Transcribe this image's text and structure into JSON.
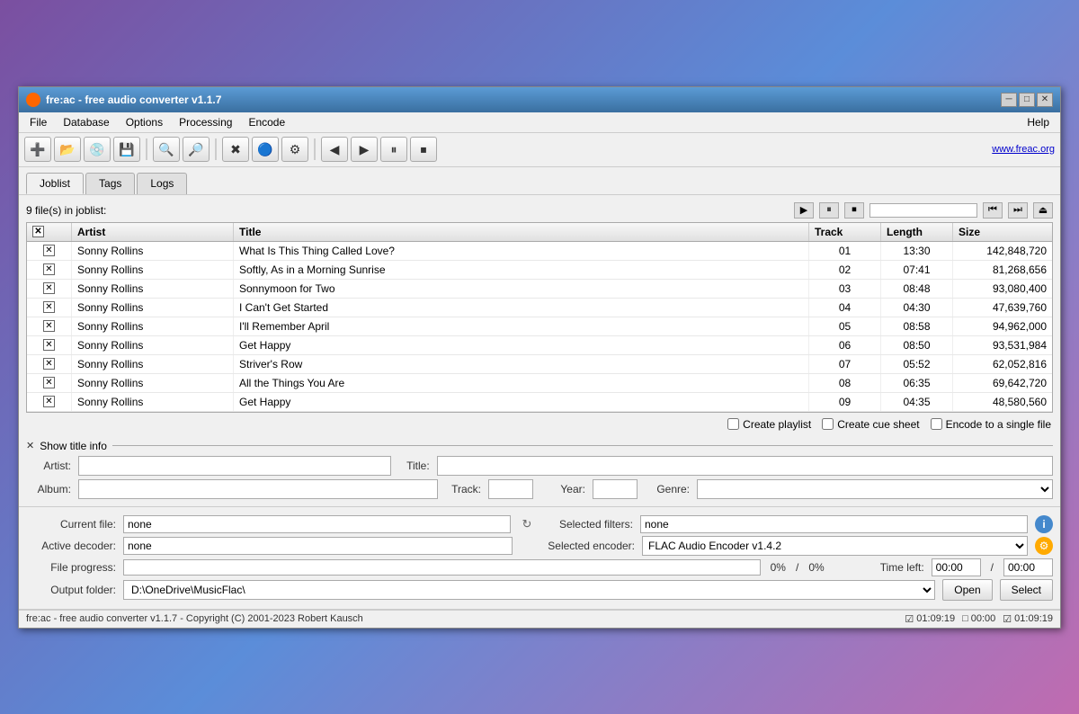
{
  "window": {
    "title": "fre:ac - free audio converter v1.1.7",
    "icon": "🎵",
    "min_btn": "─",
    "max_btn": "□",
    "close_btn": "✕"
  },
  "menubar": {
    "items": [
      "File",
      "Database",
      "Options",
      "Processing",
      "Encode"
    ],
    "help": "Help",
    "link": "www.freac.org"
  },
  "toolbar": {
    "buttons": [
      {
        "icon": "➕",
        "name": "add-file"
      },
      {
        "icon": "📂",
        "name": "open-folder"
      },
      {
        "icon": "💿",
        "name": "cd"
      },
      {
        "icon": "💾",
        "name": "save"
      },
      {
        "icon": "🔍",
        "name": "search"
      },
      {
        "icon": "⚙",
        "name": "settings"
      },
      {
        "icon": "✕",
        "name": "clear"
      },
      {
        "icon": "ℹ",
        "name": "info"
      },
      {
        "icon": "⚙",
        "name": "config"
      },
      {
        "icon": "◀",
        "name": "prev"
      },
      {
        "icon": "▶",
        "name": "play"
      },
      {
        "icon": "⏸",
        "name": "pause"
      },
      {
        "icon": "⏹",
        "name": "stop"
      }
    ]
  },
  "tabs": {
    "items": [
      "Joblist",
      "Tags",
      "Logs"
    ],
    "active": "Joblist"
  },
  "joblist": {
    "file_count": "9 file(s) in joblist:",
    "columns": {
      "artist": "Artist",
      "title": "Title",
      "track": "Track",
      "length": "Length",
      "size": "Size"
    },
    "rows": [
      {
        "checked": true,
        "artist": "Sonny Rollins",
        "title": "What Is This Thing Called Love?",
        "track": "01",
        "length": "13:30",
        "size": "142,848,720"
      },
      {
        "checked": true,
        "artist": "Sonny Rollins",
        "title": "Softly, As in a Morning Sunrise",
        "track": "02",
        "length": "07:41",
        "size": "81,268,656"
      },
      {
        "checked": true,
        "artist": "Sonny Rollins",
        "title": "Sonnymoon for Two",
        "track": "03",
        "length": "08:48",
        "size": "93,080,400"
      },
      {
        "checked": true,
        "artist": "Sonny Rollins",
        "title": "I Can't Get Started",
        "track": "04",
        "length": "04:30",
        "size": "47,639,760"
      },
      {
        "checked": true,
        "artist": "Sonny Rollins",
        "title": "I'll Remember April",
        "track": "05",
        "length": "08:58",
        "size": "94,962,000"
      },
      {
        "checked": true,
        "artist": "Sonny Rollins",
        "title": "Get Happy",
        "track": "06",
        "length": "08:50",
        "size": "93,531,984"
      },
      {
        "checked": true,
        "artist": "Sonny Rollins",
        "title": "Striver's Row",
        "track": "07",
        "length": "05:52",
        "size": "62,052,816"
      },
      {
        "checked": true,
        "artist": "Sonny Rollins",
        "title": "All the Things You Are",
        "track": "08",
        "length": "06:35",
        "size": "69,642,720"
      },
      {
        "checked": true,
        "artist": "Sonny Rollins",
        "title": "Get Happy",
        "track": "09",
        "length": "04:35",
        "size": "48,580,560"
      }
    ],
    "options": {
      "create_playlist": "Create playlist",
      "create_cue_sheet": "Create cue sheet",
      "encode_single": "Encode to a single file"
    }
  },
  "title_info": {
    "label": "Show title info",
    "artist_label": "Artist:",
    "title_label": "Title:",
    "album_label": "Album:",
    "track_label": "Track:",
    "year_label": "Year:",
    "genre_label": "Genre:",
    "artist_value": "",
    "title_value": "",
    "album_value": "",
    "track_value": "",
    "year_value": ""
  },
  "bottom": {
    "current_file_label": "Current file:",
    "current_file_value": "none",
    "selected_filters_label": "Selected filters:",
    "selected_filters_value": "none",
    "active_decoder_label": "Active decoder:",
    "active_decoder_value": "none",
    "selected_encoder_label": "Selected encoder:",
    "selected_encoder_value": "FLAC Audio Encoder v1.4.2",
    "file_progress_label": "File progress:",
    "file_progress_pct1": "0%",
    "file_progress_slash": "/",
    "file_progress_pct2": "0%",
    "time_left_label": "Time left:",
    "time_left_value1": "00:00",
    "time_left_slash": "/",
    "time_left_value2": "00:00",
    "output_folder_label": "Output folder:",
    "output_folder_value": "D:\\OneDrive\\MusicFlac\\",
    "open_btn": "Open",
    "select_btn": "Select"
  },
  "status_bar": {
    "text": "fre:ac - free audio converter v1.1.7 - Copyright (C) 2001-2023 Robert Kausch",
    "checked_icon": "☑",
    "time1": "01:09:19",
    "unchecked_icon": "□",
    "time2": "00:00",
    "checked_icon2": "☑",
    "time3": "01:09:19"
  }
}
